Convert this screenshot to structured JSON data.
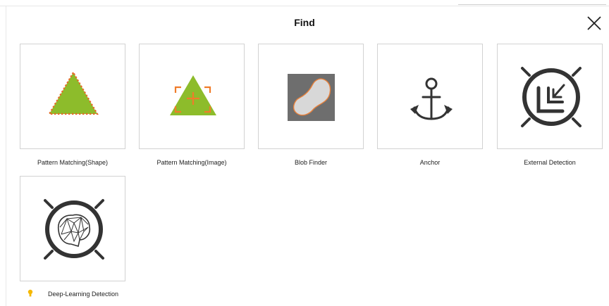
{
  "dialog": {
    "title": "Find",
    "close_icon": "close-icon"
  },
  "tools": [
    {
      "label": "Pattern Matching(Shape)",
      "icon": "triangle-outline-icon",
      "accent": "#8dbc2b"
    },
    {
      "label": "Pattern Matching(Image)",
      "icon": "triangle-crosshair-icon",
      "accent": "#8dbc2b"
    },
    {
      "label": "Blob Finder",
      "icon": "blob-icon",
      "accent": "#f07c2a"
    },
    {
      "label": "Anchor",
      "icon": "anchor-icon",
      "accent": "#333333"
    },
    {
      "label": "External Detection",
      "icon": "external-detection-icon",
      "accent": "#333333"
    },
    {
      "label": "Deep-Learning Detection",
      "icon": "brain-detection-icon",
      "accent": "#333333",
      "badge_icon": "lightbulb-icon",
      "badge_color": "#f5b800"
    }
  ]
}
